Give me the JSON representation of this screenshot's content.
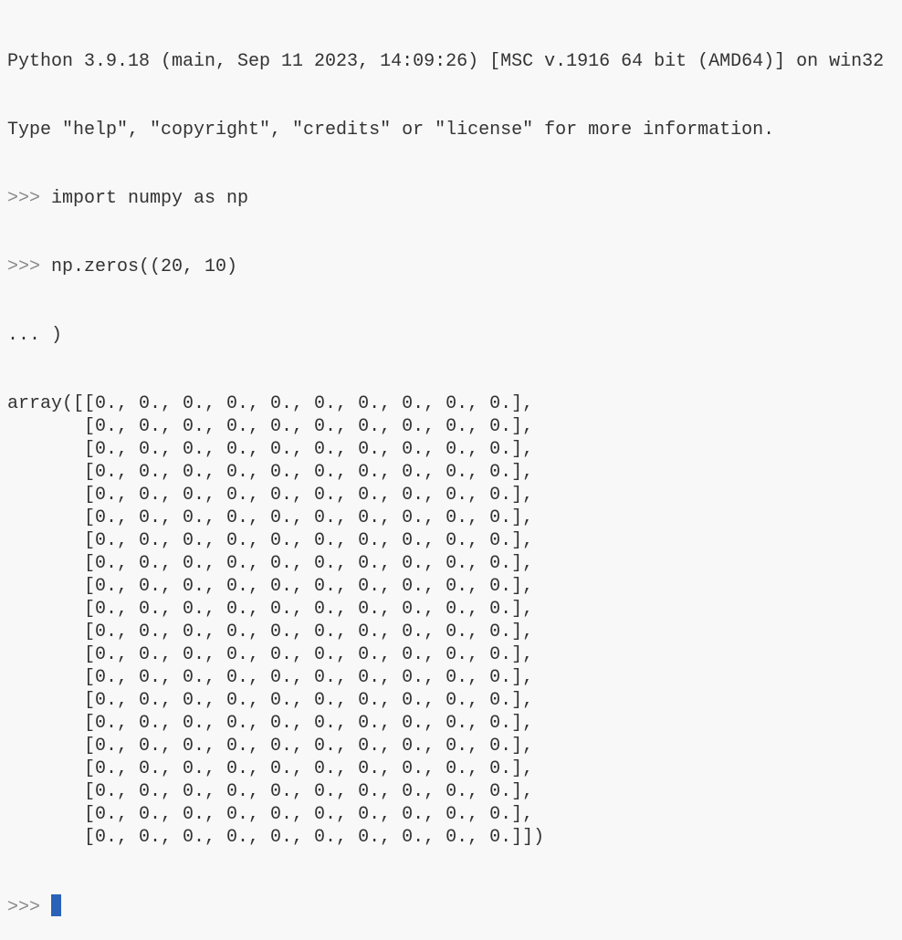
{
  "console": {
    "banner": [
      "Python 3.9.18 (main, Sep 11 2023, 14:09:26) [MSC v.1916 64 bit (AMD64)] on win32",
      "Type \"help\", \"copyright\", \"credits\" or \"license\" for more information."
    ],
    "prompt": ">>> ",
    "continuation": "... ",
    "commands": [
      "import numpy as np",
      "np.zeros((20, 10)"
    ],
    "continuation_line": ")",
    "output": [
      "array([[0., 0., 0., 0., 0., 0., 0., 0., 0., 0.],",
      "       [0., 0., 0., 0., 0., 0., 0., 0., 0., 0.],",
      "       [0., 0., 0., 0., 0., 0., 0., 0., 0., 0.],",
      "       [0., 0., 0., 0., 0., 0., 0., 0., 0., 0.],",
      "       [0., 0., 0., 0., 0., 0., 0., 0., 0., 0.],",
      "       [0., 0., 0., 0., 0., 0., 0., 0., 0., 0.],",
      "       [0., 0., 0., 0., 0., 0., 0., 0., 0., 0.],",
      "       [0., 0., 0., 0., 0., 0., 0., 0., 0., 0.],",
      "       [0., 0., 0., 0., 0., 0., 0., 0., 0., 0.],",
      "       [0., 0., 0., 0., 0., 0., 0., 0., 0., 0.],",
      "       [0., 0., 0., 0., 0., 0., 0., 0., 0., 0.],",
      "       [0., 0., 0., 0., 0., 0., 0., 0., 0., 0.],",
      "       [0., 0., 0., 0., 0., 0., 0., 0., 0., 0.],",
      "       [0., 0., 0., 0., 0., 0., 0., 0., 0., 0.],",
      "       [0., 0., 0., 0., 0., 0., 0., 0., 0., 0.],",
      "       [0., 0., 0., 0., 0., 0., 0., 0., 0., 0.],",
      "       [0., 0., 0., 0., 0., 0., 0., 0., 0., 0.],",
      "       [0., 0., 0., 0., 0., 0., 0., 0., 0., 0.],",
      "       [0., 0., 0., 0., 0., 0., 0., 0., 0., 0.],",
      "       [0., 0., 0., 0., 0., 0., 0., 0., 0., 0.]])"
    ],
    "cursor_color": "#2a62b8"
  }
}
